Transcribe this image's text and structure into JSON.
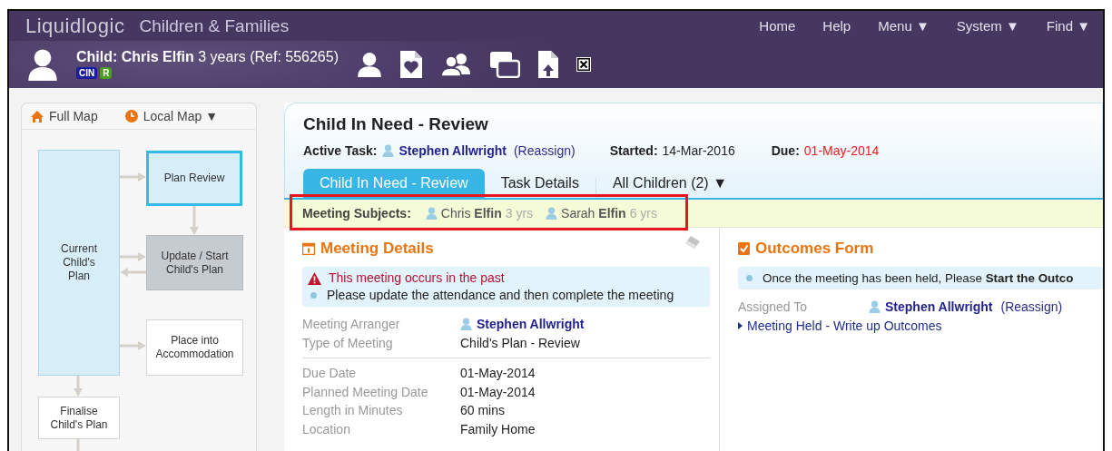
{
  "app": {
    "logo": "Liquidlogic",
    "title": "Children & Families"
  },
  "nav": [
    {
      "label": "Home"
    },
    {
      "label": "Help"
    },
    {
      "label": "Menu ▼"
    },
    {
      "label": "System ▼"
    },
    {
      "label": "Find ▼"
    }
  ],
  "child": {
    "label": "Child: Chris Elfin",
    "details": "3 years (Ref: 556265)",
    "badges": [
      {
        "text": "CIN",
        "color": "#1c1c9c"
      },
      {
        "text": "R",
        "color": "#4e9a22"
      }
    ]
  },
  "map": {
    "tabs": [
      {
        "label": "Full Map",
        "kind": "home"
      },
      {
        "label": "Local Map ▼",
        "kind": "clock"
      }
    ],
    "nodes": [
      {
        "label": "Current Child's Plan",
        "kind": "current",
        "selected": false
      },
      {
        "label": "Plan Review",
        "kind": "current",
        "selected": true
      },
      {
        "label": "Update / Start Child's Plan",
        "kind": "pending",
        "selected": false
      },
      {
        "label": "Place into Accommodation",
        "kind": "future",
        "selected": false
      },
      {
        "label": "Finalise Child's Plan",
        "kind": "future",
        "selected": false
      }
    ]
  },
  "task": {
    "title": "Child In Need - Review",
    "active_label": "Active Task:",
    "assignee": "Stephen Allwright",
    "reassign": "(Reassign)",
    "started_label": "Started:",
    "started": "14-Mar-2016",
    "due_label": "Due:",
    "due": "01-May-2014",
    "overdue": true
  },
  "tabs": [
    {
      "label": "Child In Need - Review",
      "selected": true
    },
    {
      "label": "Task Details",
      "selected": false
    },
    {
      "label": "All Children (2) ▼",
      "selected": false
    }
  ],
  "subjects": {
    "label": "Meeting Subjects:",
    "highlighted": true,
    "people": [
      {
        "first": "Chris",
        "last": "Elfin",
        "age": "3 yrs"
      },
      {
        "first": "Sarah",
        "last": "Elfin",
        "age": "6 yrs"
      }
    ]
  },
  "meeting": {
    "title": "Meeting Details",
    "alert": "This meeting occurs in the past",
    "note": "Please update the attendance and then complete the meeting",
    "field_groups": [
      [
        {
          "label": "Meeting Arranger",
          "value": "Stephen Allwright",
          "kind": "person"
        },
        {
          "label": "Type of Meeting",
          "value": "Child's Plan - Review",
          "kind": "text"
        }
      ],
      [
        {
          "label": "Due Date",
          "value": "01-May-2014",
          "kind": "text"
        },
        {
          "label": "Planned Meeting Date",
          "value": "01-May-2014",
          "kind": "text"
        },
        {
          "label": "Length in Minutes",
          "value": "60 mins",
          "kind": "text"
        },
        {
          "label": "Location",
          "value": "Family Home",
          "kind": "text"
        }
      ]
    ]
  },
  "outcomes": {
    "title": "Outcomes Form",
    "note": "Once the meeting has been held, Please **Start the Outco**",
    "assigned_label": "Assigned To",
    "assignee": "Stephen Allwright",
    "reassign": "(Reassign)",
    "action": "Meeting Held - Write up Outcomes"
  }
}
